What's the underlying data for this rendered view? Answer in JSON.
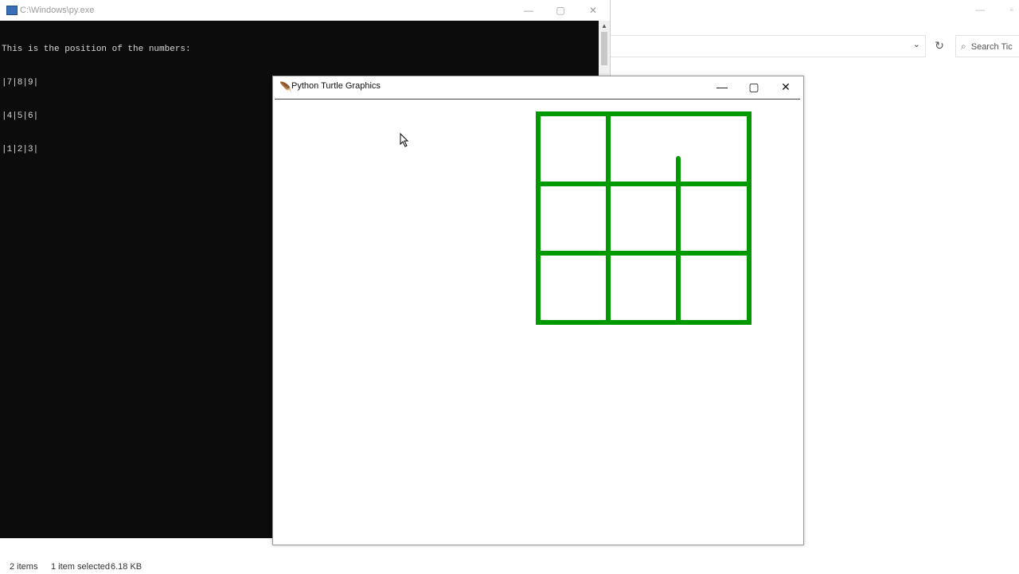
{
  "explorer": {
    "search_placeholder": "Search Tic",
    "status": {
      "items": "2 items",
      "selected": "1 item selected",
      "size": "6.18 KB"
    }
  },
  "console": {
    "title": "C:\\Windows\\py.exe",
    "lines": [
      "This is the position of the numbers:",
      "|7|8|9|",
      "|4|5|6|",
      "|1|2|3|"
    ]
  },
  "turtle": {
    "title": "Python Turtle Graphics",
    "line_color": "#009900"
  },
  "icons": {
    "minimize": "minimize-icon",
    "maximize": "maximize-icon",
    "close": "close-icon",
    "feather": "feather-icon",
    "refresh": "refresh-icon",
    "search": "search-icon",
    "dropdown": "chevron-down-icon"
  }
}
